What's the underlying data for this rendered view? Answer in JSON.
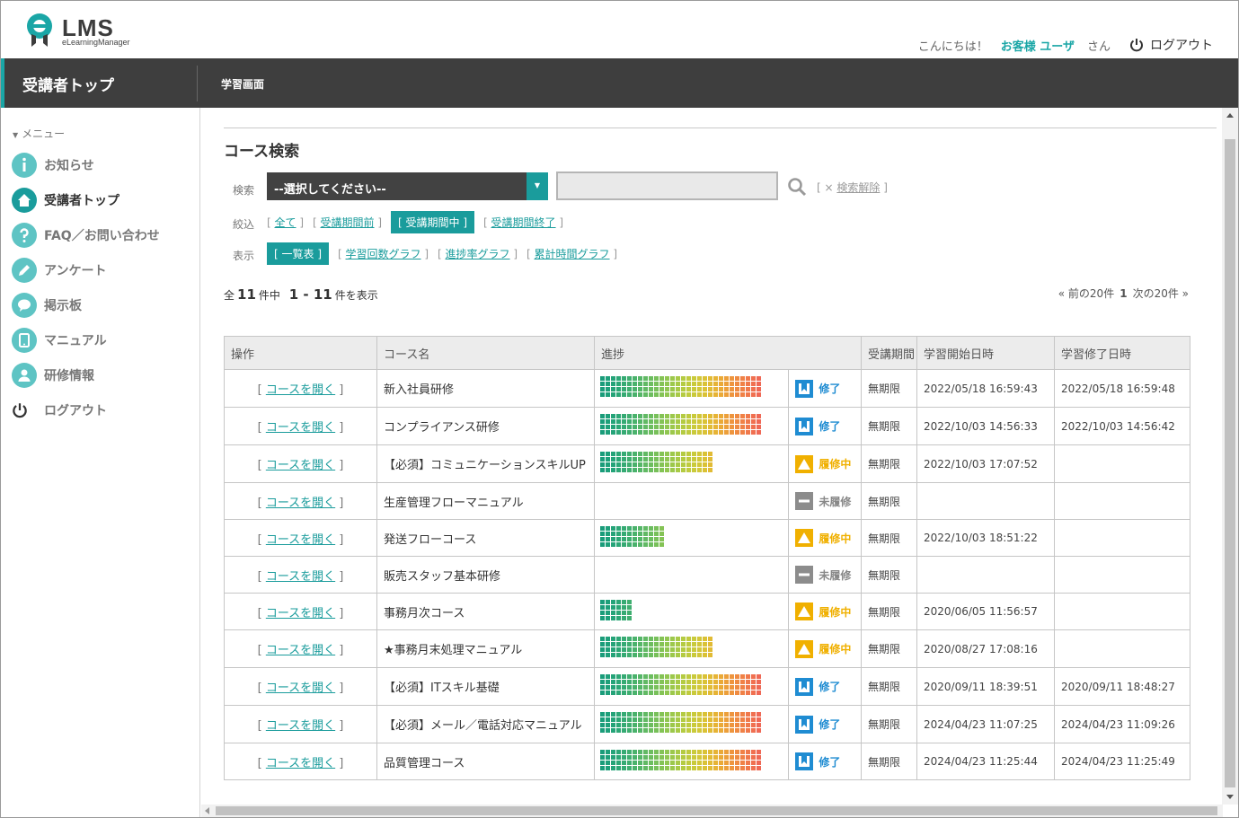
{
  "logo": {
    "name": "LMS",
    "sub": "eLearningManager"
  },
  "user": {
    "greeting": "こんにちは！",
    "name": "お客様 ユーザ",
    "suffix": "さん",
    "logout": "ログアウト"
  },
  "nav": {
    "home": "受講者トップ",
    "crumb": "学習画面"
  },
  "sidebar": {
    "title": "メニュー",
    "items": [
      {
        "label": "お知らせ",
        "icon": "info-icon"
      },
      {
        "label": "受講者トップ",
        "icon": "home-icon"
      },
      {
        "label": "FAQ／お問い合わせ",
        "icon": "question-icon"
      },
      {
        "label": "アンケート",
        "icon": "pencil-icon"
      },
      {
        "label": "掲示板",
        "icon": "speech-bubble-icon"
      },
      {
        "label": "マニュアル",
        "icon": "tablet-icon"
      },
      {
        "label": "研修情報",
        "icon": "person-icon"
      },
      {
        "label": "ログアウト",
        "icon": "power-icon"
      }
    ]
  },
  "search": {
    "title": "コース検索",
    "label_search": "検索",
    "select_value": "--選択してください--",
    "clear": "検索解除",
    "label_filter": "絞込",
    "filters": [
      "全て",
      "受講期間前",
      "受講期間中",
      "受講期間終了"
    ],
    "filter_active": 2,
    "label_view": "表示",
    "views": [
      "一覧表",
      "学習回数グラフ",
      "進捗率グラフ",
      "累計時間グラフ"
    ],
    "view_active": 0
  },
  "count": {
    "prefix": "全",
    "total": "11",
    "mid": "件中",
    "range": "1 - 11",
    "suffix": "件を表示"
  },
  "pager": {
    "prev": "« 前の20件",
    "page": "1",
    "next": "次の20件 »"
  },
  "table": {
    "headers": [
      "操作",
      "コース名",
      "進捗",
      "受講期間",
      "学習開始日時",
      "学習修了日時"
    ],
    "open_label": "コースを開く",
    "rows": [
      {
        "course": "新入社員研修",
        "progress": 100,
        "status": "修了",
        "kind": "done",
        "period": "無期限",
        "start": "2022/05/18 16:59:43",
        "end": "2022/05/18 16:59:48"
      },
      {
        "course": "コンプライアンス研修",
        "progress": 100,
        "status": "修了",
        "kind": "done",
        "period": "無期限",
        "start": "2022/10/03 14:56:33",
        "end": "2022/10/03 14:56:42"
      },
      {
        "course": "【必須】コミュニケーションスキルUP",
        "progress": 70,
        "status": "履修中",
        "kind": "wip",
        "period": "無期限",
        "start": "2022/10/03 17:07:52",
        "end": ""
      },
      {
        "course": "生産管理フローマニュアル",
        "progress": 0,
        "status": "未履修",
        "kind": "none",
        "period": "無期限",
        "start": "",
        "end": ""
      },
      {
        "course": "発送フローコース",
        "progress": 40,
        "status": "履修中",
        "kind": "wip",
        "period": "無期限",
        "start": "2022/10/03 18:51:22",
        "end": ""
      },
      {
        "course": "販売スタッフ基本研修",
        "progress": 0,
        "status": "未履修",
        "kind": "none",
        "period": "無期限",
        "start": "",
        "end": ""
      },
      {
        "course": "事務月次コース",
        "progress": 20,
        "status": "履修中",
        "kind": "wip",
        "period": "無期限",
        "start": "2020/06/05 11:56:57",
        "end": ""
      },
      {
        "course": "★事務月末処理マニュアル",
        "progress": 70,
        "status": "履修中",
        "kind": "wip",
        "period": "無期限",
        "start": "2020/08/27 17:08:16",
        "end": ""
      },
      {
        "course": "【必須】ITスキル基礎",
        "progress": 100,
        "status": "修了",
        "kind": "done",
        "period": "無期限",
        "start": "2020/09/11 18:39:51",
        "end": "2020/09/11 18:48:27"
      },
      {
        "course": "【必須】メール／電話対応マニュアル",
        "progress": 100,
        "status": "修了",
        "kind": "done",
        "period": "無期限",
        "start": "2024/04/23 11:07:25",
        "end": "2024/04/23 11:09:26"
      },
      {
        "course": "品質管理コース",
        "progress": 100,
        "status": "修了",
        "kind": "done",
        "period": "無期限",
        "start": "2024/04/23 11:25:44",
        "end": "2024/04/23 11:25:49"
      }
    ]
  },
  "colors": {
    "teal": "#1a9c9c",
    "done": "#1f8cd2",
    "wip": "#f0b000",
    "none": "#8c8c8c"
  }
}
